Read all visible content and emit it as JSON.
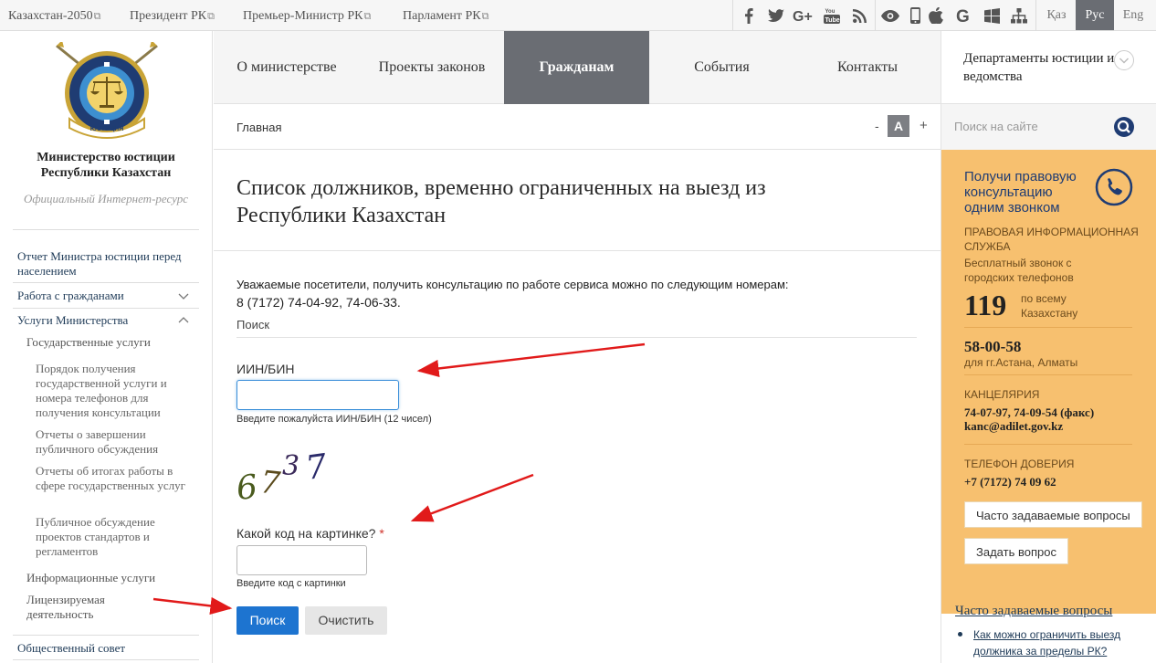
{
  "topbar": {
    "links": [
      {
        "label": "Казахстан-2050",
        "ext": "⧉"
      },
      {
        "label": "Президент РК",
        "ext": "⧉"
      },
      {
        "label": "Премьер-Министр РК",
        "ext": "⧉"
      },
      {
        "label": "Парламент РК",
        "ext": "⧉"
      }
    ],
    "social_icons": [
      "facebook-icon",
      "twitter-icon",
      "google-plus-icon",
      "youtube-icon",
      "rss-icon"
    ],
    "app_icons": [
      "eye-icon",
      "mobile-icon",
      "apple-icon",
      "google-icon",
      "windows-icon",
      "sitemap-icon"
    ],
    "languages": [
      {
        "label": "Қаз",
        "active": false
      },
      {
        "label": "Рус",
        "active": true
      },
      {
        "label": "Eng",
        "active": false
      }
    ]
  },
  "sidebar": {
    "ministry_name": "Министерство юстиции Республики Казахстан",
    "official_label": "Официальный Интернет-ресурс",
    "emblem_text": "ЮСТИЦИЯ",
    "nav": {
      "report": "Отчет Министра юстиции перед населением",
      "work": "Работа с гражданами",
      "services": "Услуги Министерства",
      "gov_services": "Государственные услуги",
      "procedure": "Порядок получения государственной услуги и номера телефонов для получения консультации",
      "discussion_reports": "Отчеты о завершении публичного обсуждения",
      "work_results": "Отчеты об итогах работы в сфере государственных услуг",
      "public_discussion": "Публичное обсуждение проектов стандартов и регламентов",
      "info_services": "Информационные услуги",
      "licensed": "Лицензируемая деятельность",
      "council": "Общественный совет"
    }
  },
  "mainnav": {
    "items": [
      {
        "label": "О министерстве"
      },
      {
        "label": "Проекты законов"
      },
      {
        "label": "Гражданам"
      },
      {
        "label": "События"
      },
      {
        "label": "Контакты"
      }
    ]
  },
  "breadcrumb": {
    "home": "Главная",
    "font_minus": "-",
    "font_a": "A",
    "font_plus": "+"
  },
  "main": {
    "title": "Список должников, временно ограниченных на выезд из Республики Казахстан",
    "notice_line1": "Уважаемые посетители, получить консультацию по работе сервиса можно по следующим номерам:",
    "notice_line2": "8 (7172) 74-04-92, 74-06-33.",
    "search_heading": "Поиск",
    "iin_label": "ИИН/БИН",
    "iin_value": "",
    "iin_hint": "Введите пожалуйста ИИН/БИН (12 чисел)",
    "captcha_text": "6737",
    "captcha_label": "Какой код на картинке?",
    "required_mark": "*",
    "captcha_value": "",
    "captcha_hint": "Введите код с картинки",
    "search_button": "Поиск",
    "clear_button": "Очистить"
  },
  "right": {
    "departments": "Департаменты юстиции и ведомства",
    "search_placeholder": "Поиск на сайте",
    "consult_title": "Получи правовую консультацию одним звонком",
    "service_name": "ПРАВОВАЯ ИНФОРМАЦИОННАЯ СЛУЖБА",
    "free_call": "Бесплатный звонок с городских телефонов",
    "number_119": "119",
    "number_119_note": "по всему Казахстану",
    "city_number": "58-00-58",
    "city_note": "для гг.Астана, Алматы",
    "office_label": "КАНЦЕЛЯРИЯ",
    "office_phones": "74-07-97, 74-09-54 (факс)",
    "office_email": "kanc@adilet.gov.kz",
    "trust_label": "ТЕЛЕФОН ДОВЕРИЯ",
    "trust_phone": "+7 (7172) 74 09 62",
    "faq_button": "Часто задаваемые вопросы",
    "ask_button": "Задать вопрос",
    "faq_heading": "Часто задаваемые вопросы",
    "faq_item": "Как можно ограничить выезд должника за пределы РК?"
  },
  "colors": {
    "accent_blue": "#1d74d0",
    "active_gray": "#6a6d73",
    "orange_panel": "#f7c06f",
    "annotation_red": "#e11a1a",
    "nav_link": "#1e3a57"
  }
}
